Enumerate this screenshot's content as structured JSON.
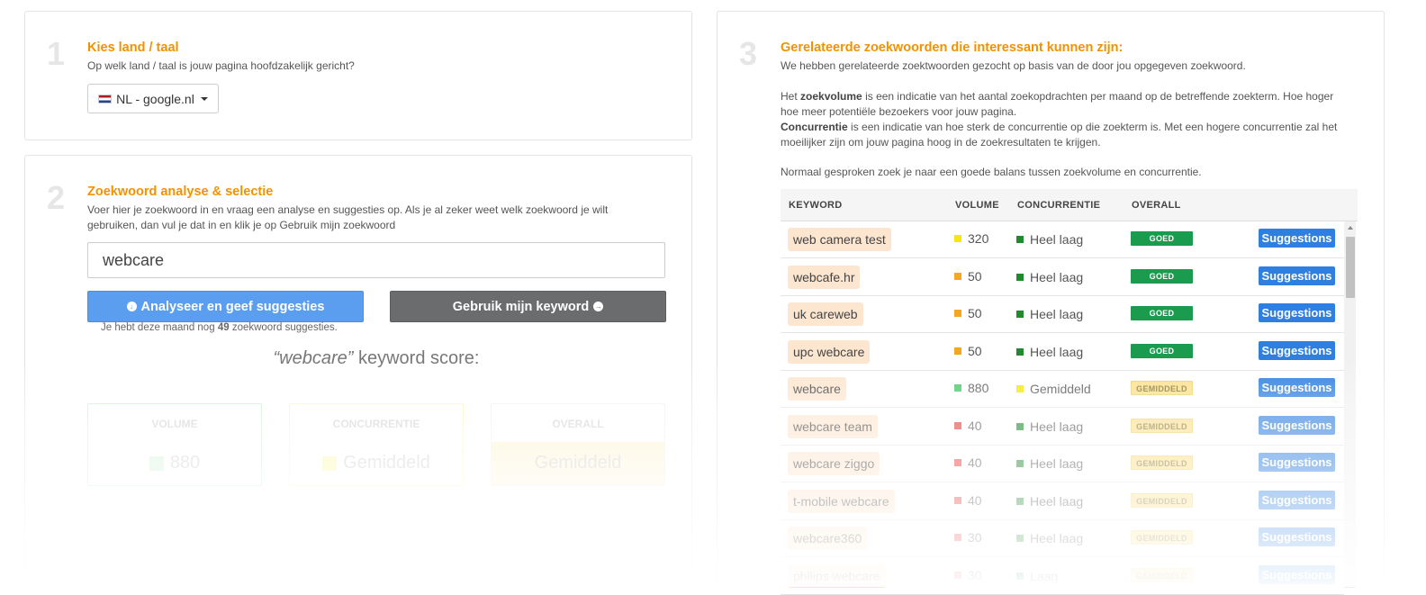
{
  "step1": {
    "number": "1",
    "title": "Kies land / taal",
    "subtitle": "Op welk land / taal is jouw pagina hoofdzakelijk gericht?",
    "selected_country": "NL - google.nl"
  },
  "step2": {
    "number": "2",
    "title": "Zoekwoord analyse & selectie",
    "desc1": "Voer hier je zoekwoord in en vraag een analyse en suggesties op. Als je al zeker weet welk zoekwoord je wilt",
    "desc2": "gebruiken, dan vul je dat in en klik je op Gebruik mijn zoekwoord",
    "keyword_value": "webcare",
    "analyse_label": "Analyseer en geef suggesties",
    "use_label": "Gebruik mijn keyword",
    "remaining_prefix": "Je hebt deze maand nog",
    "remaining_count": "49",
    "remaining_suffix": "zoekwoord suggesties.",
    "score_keyword": "“webcare”",
    "score_suffix": "keyword score:",
    "volume_label": "VOLUME",
    "volume_value": "880",
    "concurrentie_label": "CONCURRENTIE",
    "concurrentie_value": "Gemiddeld",
    "overall_label": "OVERALL",
    "overall_value": "Gemiddeld",
    "colors": {
      "volume": "#4cc86a",
      "concurrentie": "#ffee33",
      "overall": "#fbe08a"
    }
  },
  "step3": {
    "number": "3",
    "title": "Gerelateerde zoekwoorden die interessant kunnen zijn:",
    "line1": "We hebben gerelateerde zoektwoorden gezocht op basis van de door jou opgegeven zoekwoord.",
    "p2_pre": "Het",
    "p2_bold": "zoekvolume",
    "p2_rest": "is een indicatie van het aantal zoekopdrachten per maand op de betreffende zoekterm. Hoe hoger",
    "p2_line2": "hoe meer potentiële bezoekers voor jouw pagina.",
    "p3_bold": "Concurrentie",
    "p3_rest": "is een indicatie van hoe sterk de concurrentie op die zoekterm is. Met een hogere concurrentie zal het",
    "p3_line2": "moeilijker zijn om jouw pagina hoog in de zoekresultaten te krijgen.",
    "p4": "Normaal gesproken zoek je naar een goede balans tussen zoekvolume en concurrentie.",
    "headers": {
      "keyword": "KEYWORD",
      "volume": "VOLUME",
      "concurrentie": "CONCURRENTIE",
      "overall": "OVERALL"
    },
    "suggest_label": "Suggestions",
    "rows": [
      {
        "keyword": "web camera test",
        "volume": "320",
        "vol_color": "#f5e90c",
        "conc": "Heel laag",
        "conc_color": "#1f8a2e",
        "overall": "GOED"
      },
      {
        "keyword": "webcafe.hr",
        "volume": "50",
        "vol_color": "#f5a623",
        "conc": "Heel laag",
        "conc_color": "#1f8a2e",
        "overall": "GOED"
      },
      {
        "keyword": "uk careweb",
        "volume": "50",
        "vol_color": "#f5a623",
        "conc": "Heel laag",
        "conc_color": "#1f8a2e",
        "overall": "GOED"
      },
      {
        "keyword": "upc webcare",
        "volume": "50",
        "vol_color": "#f5a623",
        "conc": "Heel laag",
        "conc_color": "#1f8a2e",
        "overall": "GOED"
      },
      {
        "keyword": "webcare",
        "volume": "880",
        "vol_color": "#4cc86a",
        "conc": "Gemiddeld",
        "conc_color": "#f5e90c",
        "overall": "GEMIDDELD"
      },
      {
        "keyword": "webcare team",
        "volume": "40",
        "vol_color": "#e83b3b",
        "conc": "Heel laag",
        "conc_color": "#1f8a2e",
        "overall": "GEMIDDELD"
      },
      {
        "keyword": "webcare ziggo",
        "volume": "40",
        "vol_color": "#e83b3b",
        "conc": "Heel laag",
        "conc_color": "#1f8a2e",
        "overall": "GEMIDDELD"
      },
      {
        "keyword": "t-mobile webcare",
        "volume": "40",
        "vol_color": "#e83b3b",
        "conc": "Heel laag",
        "conc_color": "#1f8a2e",
        "overall": "GEMIDDELD"
      },
      {
        "keyword": "webcare360",
        "volume": "30",
        "vol_color": "#e83b3b",
        "conc": "Heel laag",
        "conc_color": "#1f8a2e",
        "overall": "GEMIDDELD"
      },
      {
        "keyword": "philips webcare",
        "volume": "30",
        "vol_color": "#e83b3b",
        "conc": "Laag",
        "conc_color": "#1f8a2e",
        "overall": "GEMIDDELD"
      }
    ]
  }
}
